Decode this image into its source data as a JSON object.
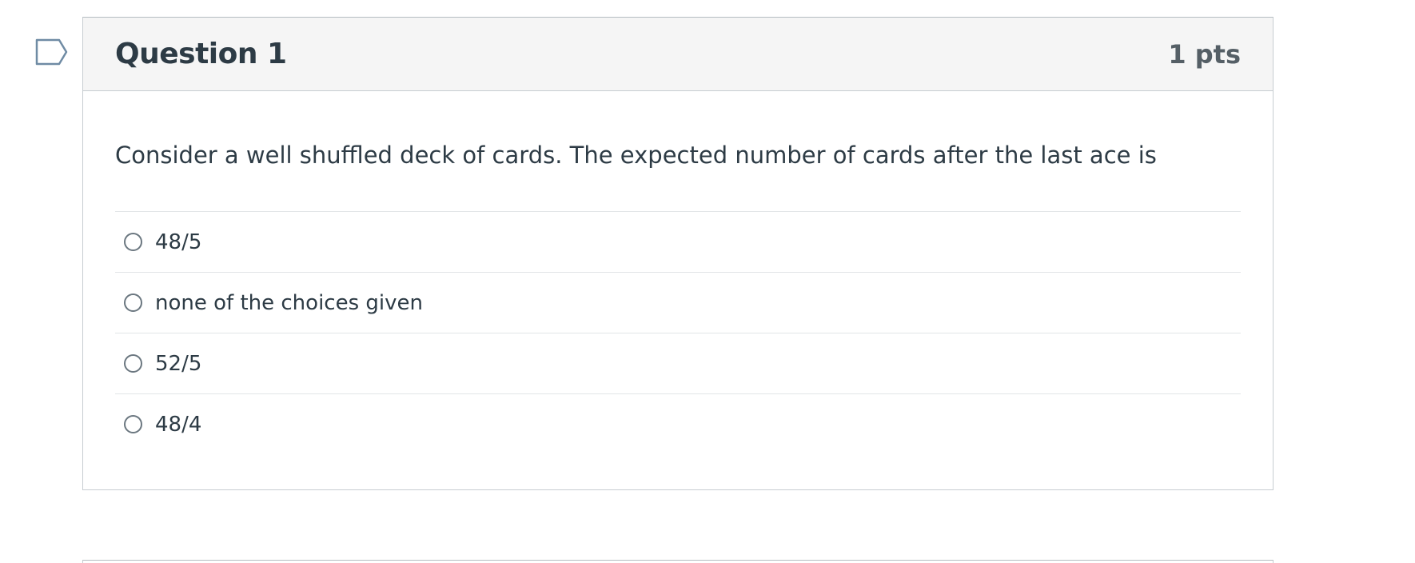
{
  "question": {
    "title": "Question 1",
    "points": "1 pts",
    "text": "Consider a well shuffled deck of cards. The expected number of cards after the last ace is",
    "flag_icon": "flag-bookmark-icon",
    "answers": [
      {
        "label": "48/5",
        "selected": false
      },
      {
        "label": "none of the choices given",
        "selected": false
      },
      {
        "label": "52/5",
        "selected": false
      },
      {
        "label": "48/4",
        "selected": false
      }
    ]
  },
  "colors": {
    "header_bg": "#f5f5f5",
    "text": "#2d3b45",
    "points": "#555f66",
    "border": "#c7cdd1",
    "flag": "#6f8ba4"
  }
}
